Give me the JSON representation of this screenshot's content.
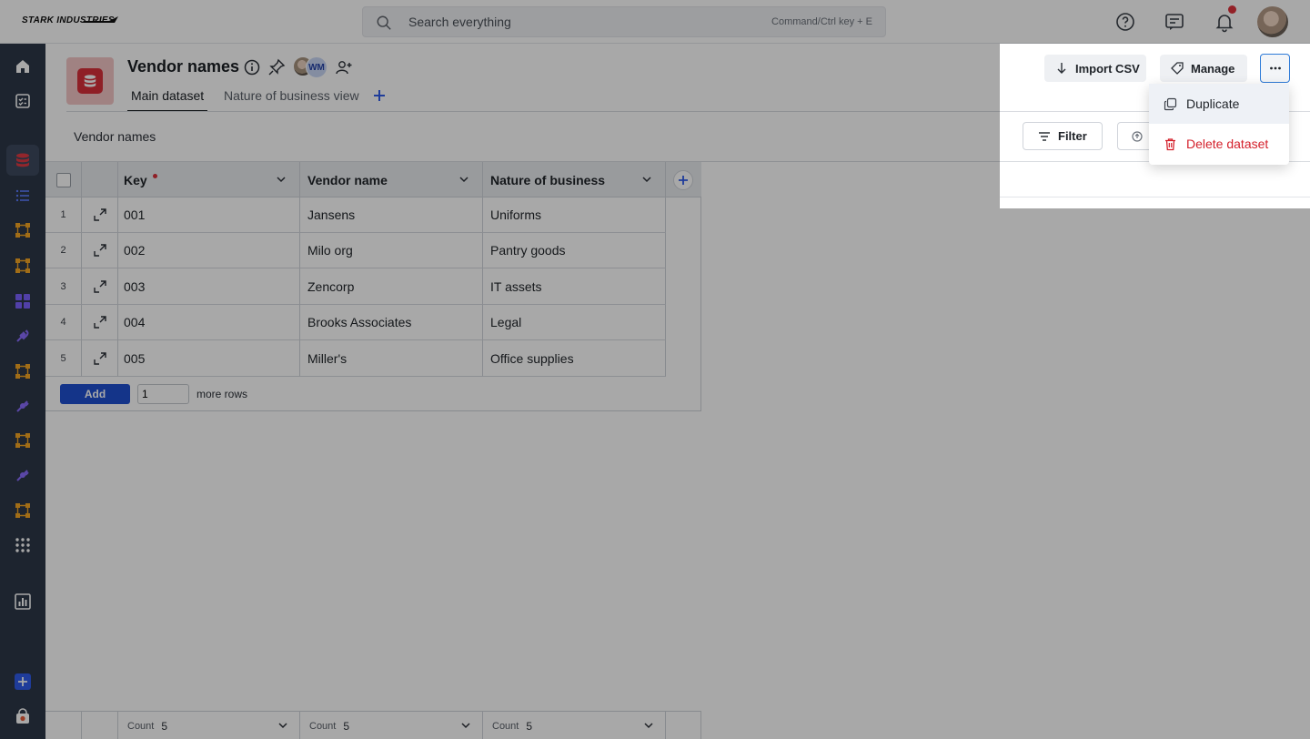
{
  "brand": {
    "logo_text": "STARK INDUSTRIES"
  },
  "search": {
    "placeholder": "Search everything",
    "shortcut_hint": "Command/Ctrl key + E"
  },
  "dataset": {
    "title": "Vendor names",
    "collaborator_initials": "WM",
    "tabs": [
      {
        "label": "Main dataset"
      },
      {
        "label": "Nature of business view"
      }
    ],
    "view_name": "Vendor names"
  },
  "toolbar": {
    "import_label": "Import CSV",
    "manage_label": "Manage",
    "filter_label": "Filter"
  },
  "menu": {
    "items": [
      {
        "label": "Duplicate"
      },
      {
        "label": "Delete dataset"
      }
    ]
  },
  "table": {
    "columns": [
      {
        "label": "Key",
        "required": true
      },
      {
        "label": "Vendor name"
      },
      {
        "label": "Nature of business"
      }
    ],
    "rows": [
      {
        "num": "1",
        "key": "001",
        "vendor": "Jansens",
        "nature": "Uniforms"
      },
      {
        "num": "2",
        "key": "002",
        "vendor": "Milo org",
        "nature": "Pantry goods"
      },
      {
        "num": "3",
        "key": "003",
        "vendor": "Zencorp",
        "nature": "IT assets"
      },
      {
        "num": "4",
        "key": "004",
        "vendor": "Brooks Associates",
        "nature": "Legal"
      },
      {
        "num": "5",
        "key": "005",
        "vendor": "Miller's",
        "nature": "Office supplies"
      }
    ],
    "add_row": {
      "button_label": "Add",
      "count_value": "1",
      "suffix": "more rows"
    },
    "footer": [
      {
        "label": "Count",
        "value": "5"
      },
      {
        "label": "Count",
        "value": "5"
      },
      {
        "label": "Count",
        "value": "5"
      }
    ]
  },
  "colors": {
    "accent": "#1f4fd1",
    "danger": "#d4212c",
    "nav_bg": "#2d3748",
    "dataset_red": "#d92f3a"
  }
}
